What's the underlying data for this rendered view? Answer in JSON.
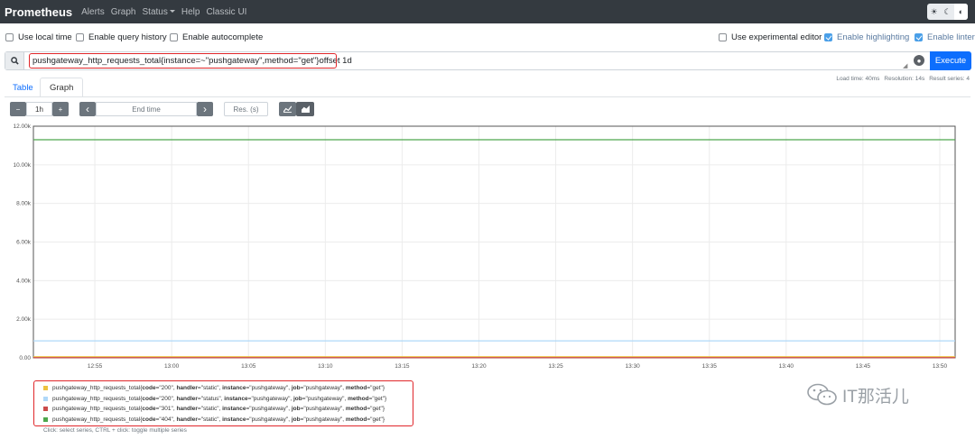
{
  "navbar": {
    "brand": "Prometheus",
    "links": [
      "Alerts",
      "Graph",
      "Status",
      "Help",
      "Classic UI"
    ]
  },
  "options": {
    "use_local_time": {
      "label": "Use local time",
      "checked": false
    },
    "query_history": {
      "label": "Enable query history",
      "checked": false
    },
    "autocomplete": {
      "label": "Enable autocomplete",
      "checked": false
    },
    "experimental_editor": {
      "label": "Use experimental editor",
      "checked": false
    },
    "highlighting": {
      "label": "Enable highlighting",
      "checked": true
    },
    "linter": {
      "label": "Enable linter",
      "checked": true
    }
  },
  "query": {
    "expression": "pushgateway_http_requests_total{instance=~\"pushgateway\",method=\"get\"}offset 1d",
    "execute_label": "Execute"
  },
  "tabs": {
    "table": "Table",
    "graph": "Graph"
  },
  "stats": {
    "load_time": "Load time: 40ms",
    "resolution": "Resolution: 14s",
    "result_series": "Result series: 4"
  },
  "controls": {
    "minus": "−",
    "range": "1h",
    "plus": "+",
    "prev": "‹",
    "end_time_placeholder": "End time",
    "next": "›",
    "res_placeholder": "Res. (s)"
  },
  "chart_data": {
    "type": "line",
    "title": "",
    "xlabel": "",
    "ylabel": "",
    "ylim": [
      0,
      12000
    ],
    "y_ticks": [
      "0.00",
      "2.00k",
      "4.00k",
      "6.00k",
      "8.00k",
      "10.00k",
      "12.00k"
    ],
    "x_ticks": [
      "12:55",
      "13:00",
      "13:05",
      "13:10",
      "13:15",
      "13:20",
      "13:25",
      "13:30",
      "13:35",
      "13:40",
      "13:45",
      "13:50"
    ],
    "x": [
      "12:51",
      "13:51"
    ],
    "series": [
      {
        "name": "pushgateway_http_requests_total{code=\"200\", handler=\"static\", instance=\"pushgateway\", job=\"pushgateway\", method=\"get\"}",
        "color": "#edc240",
        "values": [
          60,
          60
        ]
      },
      {
        "name": "pushgateway_http_requests_total{code=\"200\", handler=\"status\", instance=\"pushgateway\", job=\"pushgateway\", method=\"get\"}",
        "color": "#afd8f8",
        "values": [
          880,
          880
        ]
      },
      {
        "name": "pushgateway_http_requests_total{code=\"301\", handler=\"static\", instance=\"pushgateway\", job=\"pushgateway\", method=\"get\"}",
        "color": "#cb4b4b",
        "values": [
          10,
          10
        ]
      },
      {
        "name": "pushgateway_http_requests_total{code=\"404\", handler=\"static\", instance=\"pushgateway\", job=\"pushgateway\", method=\"get\"}",
        "color": "#4da74d",
        "values": [
          11300,
          11300
        ]
      }
    ]
  },
  "legend": {
    "items": [
      {
        "prefix": "pushgateway_http_requests_total{",
        "code": "\"200\"",
        "handler": "\"static\"",
        "color": "#edc240"
      },
      {
        "prefix": "pushgateway_http_requests_total{",
        "code": "\"200\"",
        "handler": "\"status\"",
        "color": "#afd8f8"
      },
      {
        "prefix": "pushgateway_http_requests_total{",
        "code": "\"301\"",
        "handler": "\"static\"",
        "color": "#cb4b4b"
      },
      {
        "prefix": "pushgateway_http_requests_total{",
        "code": "\"404\"",
        "handler": "\"static\"",
        "color": "#4da74d"
      }
    ],
    "hint": "Click: select series, CTRL + click: toggle multiple series"
  },
  "watermark": {
    "text": "IT那活儿"
  }
}
